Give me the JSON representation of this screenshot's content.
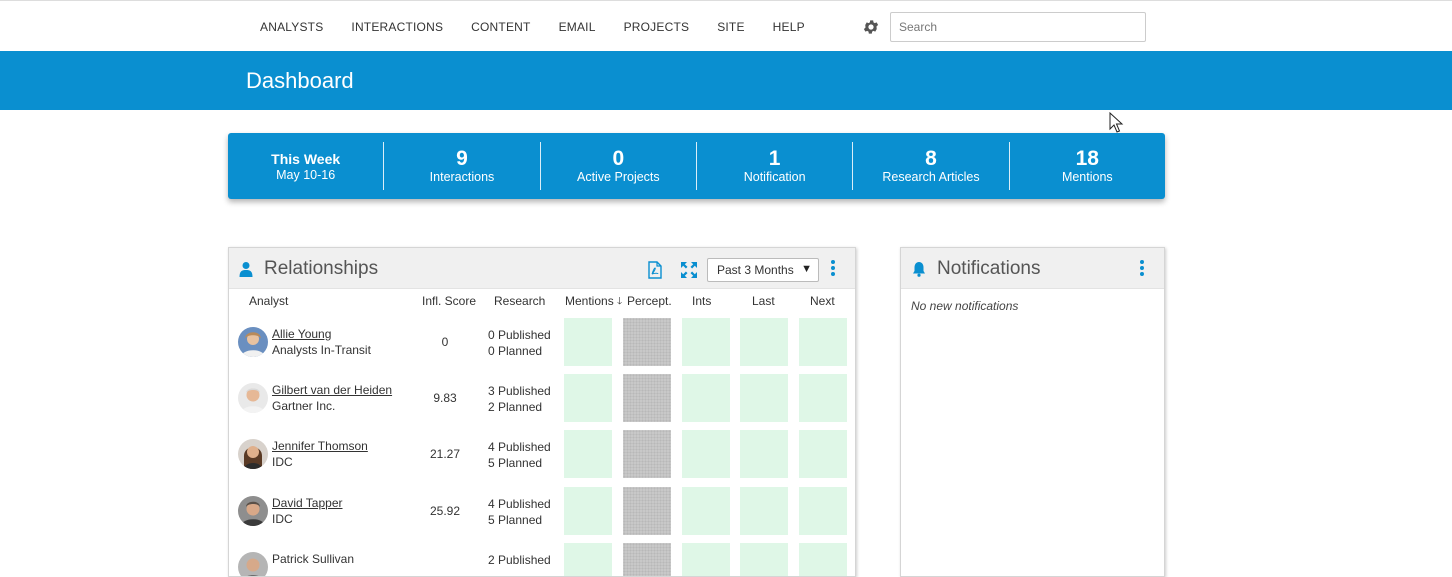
{
  "nav": {
    "items": [
      "ANALYSTS",
      "INTERACTIONS",
      "CONTENT",
      "EMAIL",
      "PROJECTS",
      "SITE",
      "HELP"
    ],
    "search_placeholder": "Search"
  },
  "header": {
    "title": "Dashboard"
  },
  "stats": {
    "week_title": "This Week",
    "week_range": "May 10-16",
    "items": [
      {
        "value": "9",
        "label": "Interactions"
      },
      {
        "value": "0",
        "label": "Active Projects"
      },
      {
        "value": "1",
        "label": "Notification"
      },
      {
        "value": "8",
        "label": "Research Articles"
      },
      {
        "value": "18",
        "label": "Mentions"
      }
    ]
  },
  "relationships": {
    "title": "Relationships",
    "period": "Past 3 Months",
    "columns": {
      "analyst": "Analyst",
      "score": "Infl. Score",
      "research": "Research",
      "mentions": "Mentions",
      "sort_arrow": "🡓",
      "percept": "Percept.",
      "ints": "Ints",
      "last": "Last",
      "next": "Next"
    },
    "rows": [
      {
        "name": "Allie Young",
        "org": "Analysts In-Transit",
        "score": "0",
        "published": "0 Published",
        "planned": "0 Planned"
      },
      {
        "name": "Gilbert van der Heiden",
        "org": "Gartner Inc.",
        "score": "9.83",
        "published": "3 Published",
        "planned": "2 Planned"
      },
      {
        "name": "Jennifer Thomson",
        "org": "IDC",
        "score": "21.27",
        "published": "4 Published",
        "planned": "5 Planned"
      },
      {
        "name": "David Tapper",
        "org": "IDC",
        "score": "25.92",
        "published": "4 Published",
        "planned": "5 Planned"
      },
      {
        "name": "Patrick Sullivan",
        "org": "",
        "score": "",
        "published": "2 Published",
        "planned": ""
      }
    ]
  },
  "notifications": {
    "title": "Notifications",
    "empty_text": "No new notifications"
  },
  "colors": {
    "brand_blue": "#0a8fd0",
    "cell_green": "#dff7e7",
    "cell_gray": "#c8c8c8"
  }
}
